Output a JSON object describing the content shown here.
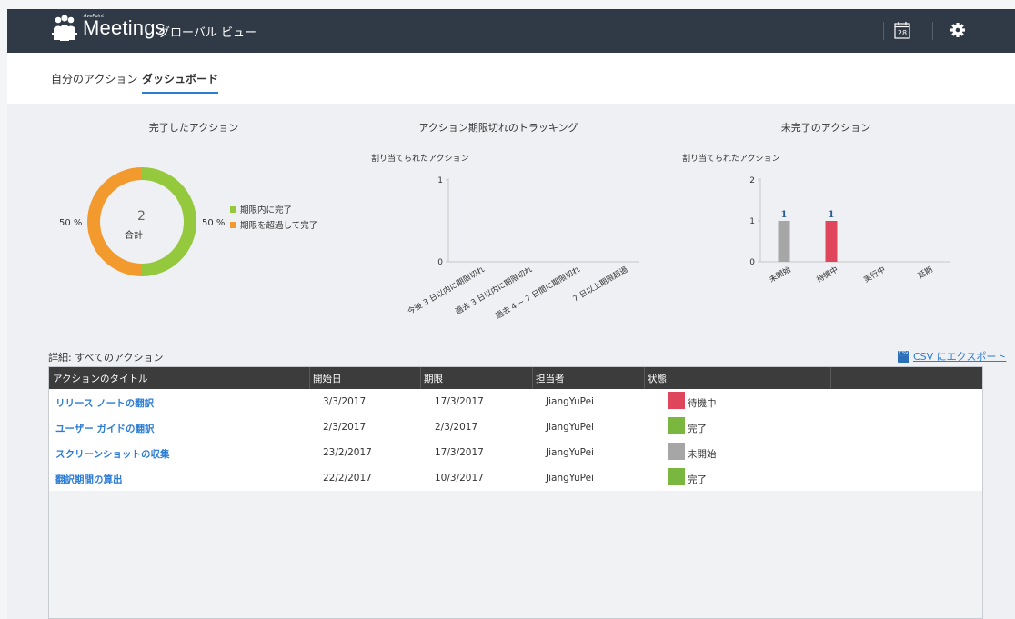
{
  "header": {
    "brand": "Meetings",
    "brand_tag": "AvePoint",
    "view_title": "グローバル ビュー",
    "calendar_day": "28"
  },
  "tabs": [
    {
      "label": "自分のアクション",
      "active": false
    },
    {
      "label": "ダッシュボード",
      "active": true
    }
  ],
  "panels": {
    "completed": {
      "title": "完了したアクション",
      "total_value": "2",
      "total_label": "合計",
      "left_pct": "50 %",
      "right_pct": "50 %",
      "legend": [
        {
          "label": "期限内に完了",
          "color": "#95c93d"
        },
        {
          "label": "期限を超過して完了",
          "color": "#f39a2f"
        }
      ]
    },
    "overdue": {
      "title": "アクション期限切れのトラッキング",
      "ylabel": "割り当てられたアクション"
    },
    "incomplete": {
      "title": "未完了のアクション",
      "ylabel": "割り当てられたアクション"
    }
  },
  "chart_data": [
    {
      "type": "pie",
      "title": "完了したアクション",
      "categories": [
        "期限内に完了",
        "期限を超過して完了"
      ],
      "values": [
        1,
        1
      ],
      "colors": [
        "#95c93d",
        "#f39a2f"
      ]
    },
    {
      "type": "bar",
      "title": "アクション期限切れのトラッキング",
      "ylabel": "割り当てられたアクション",
      "categories": [
        "今後 3 日以内に期限切れ",
        "過去 3 日以内に期限切れ",
        "過去 4 ~ 7 日間に期限切れ",
        "7 日以上期限超過"
      ],
      "values": [
        0,
        0,
        0,
        0
      ],
      "ylim": [
        0,
        1
      ],
      "yticks": [
        "0",
        "1"
      ]
    },
    {
      "type": "bar",
      "title": "未完了のアクション",
      "ylabel": "割り当てられたアクション",
      "categories": [
        "未開始",
        "待機中",
        "実行中",
        "延期"
      ],
      "values": [
        1,
        1,
        0,
        0
      ],
      "colors": [
        "#a6a6a6",
        "#e0465b",
        "#a6a6a6",
        "#a6a6a6"
      ],
      "data_labels": [
        "1",
        "1",
        "",
        ""
      ],
      "ylim": [
        0,
        2
      ],
      "yticks": [
        "0",
        "1",
        "2"
      ]
    }
  ],
  "details": {
    "label": "詳細:   すべてのアクション",
    "export_label": "CSV にエクスポート",
    "export_icon": "CSV"
  },
  "table": {
    "columns": [
      "アクションのタイトル",
      "開始日",
      "期限",
      "担当者",
      "状態"
    ],
    "rows": [
      {
        "title": "リリース ノートの翻訳",
        "start": "3/3/2017",
        "due": "17/3/2017",
        "assignee": "JiangYuPei",
        "status": "待機中",
        "status_color": "#e0465b"
      },
      {
        "title": "ユーザー ガイドの翻訳",
        "start": "2/3/2017",
        "due": "2/3/2017",
        "assignee": "JiangYuPei",
        "status": "完了",
        "status_color": "#7ab73f"
      },
      {
        "title": "スクリーンショットの収集",
        "start": "23/2/2017",
        "due": "17/3/2017",
        "assignee": "JiangYuPei",
        "status": "未開始",
        "status_color": "#a6a6a6"
      },
      {
        "title": "翻訳期間の算出",
        "start": "22/2/2017",
        "due": "10/3/2017",
        "assignee": "JiangYuPei",
        "status": "完了",
        "status_color": "#7ab73f"
      }
    ]
  }
}
